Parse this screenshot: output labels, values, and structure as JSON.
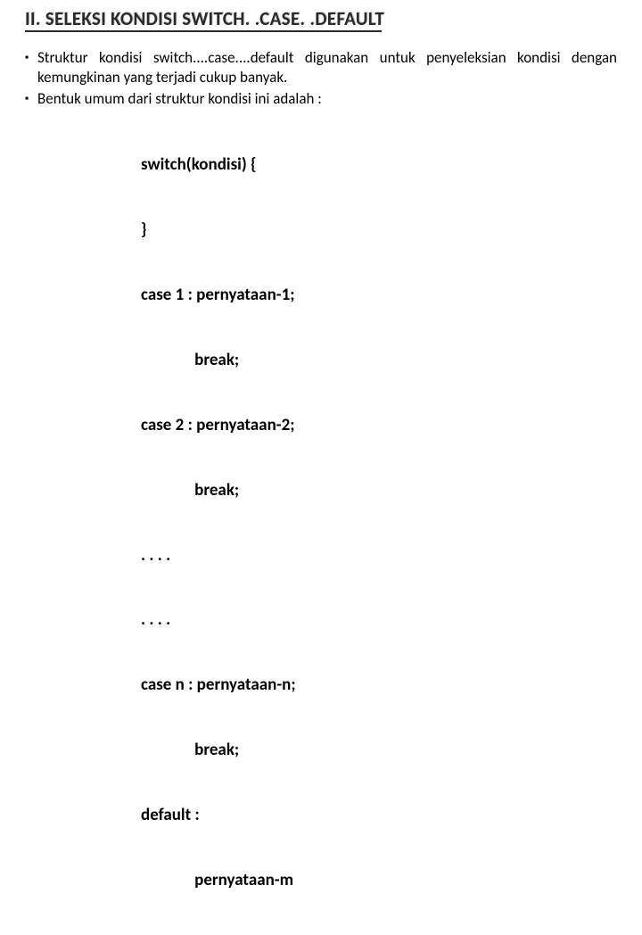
{
  "title": "II. SELEKSI KONDISI SWITCH. .CASE. .DEFAULT",
  "bullets": [
    "Struktur kondisi switch....case....default digunakan untuk penyeleksian kondisi dengan kemungkinan yang terjadi cukup banyak.",
    "Bentuk umum dari struktur kondisi ini adalah :"
  ],
  "code_lines": [
    "switch(kondisi) {",
    "}",
    "case 1 : pernyataan-1;",
    "              break;",
    "case 2 : pernyataan-2;",
    "              break;",
    ". . . .",
    ". . . .",
    "case n : pernyataan-n;",
    "              break;",
    "default :",
    "              pernyataan-m"
  ]
}
